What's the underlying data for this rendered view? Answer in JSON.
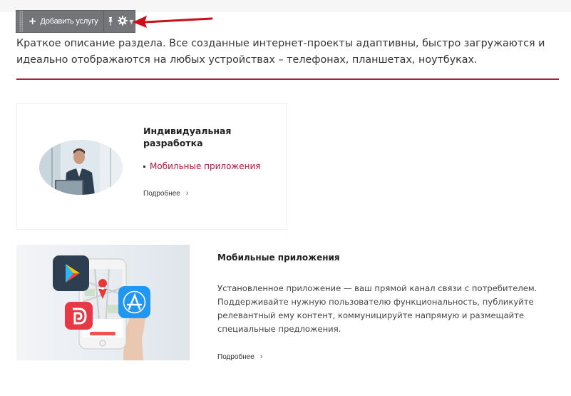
{
  "toolbar": {
    "add_service_label": "Добавить услугу",
    "icons": [
      "plus-icon",
      "pin-icon",
      "gear-icon",
      "chevron-down-icon"
    ]
  },
  "section": {
    "description": "Краткое описание раздела. Все созданные интернет-проекты адаптивны, быстро загружаются и идеально отображаются на любых устройствах – телефонах, планшетах, ноутбуках."
  },
  "services": [
    {
      "title": "Индивидуальная разработка",
      "subservices": [
        "Мобильные приложения"
      ],
      "more_label": "Подробнее"
    },
    {
      "title": "Мобильные приложения",
      "text": "Установленное приложение — ваш прямой канал связи с потребителем. Поддерживайте нужную пользователю функциональность, публикуйте релевантный ему контент, коммуницируйте напрямую и размещайте специальные предложения.",
      "more_label": "Подробнее"
    }
  ],
  "colors": {
    "accent": "#b4193a",
    "toolbar_bg": "#737579",
    "arrow": "#c8101b"
  }
}
